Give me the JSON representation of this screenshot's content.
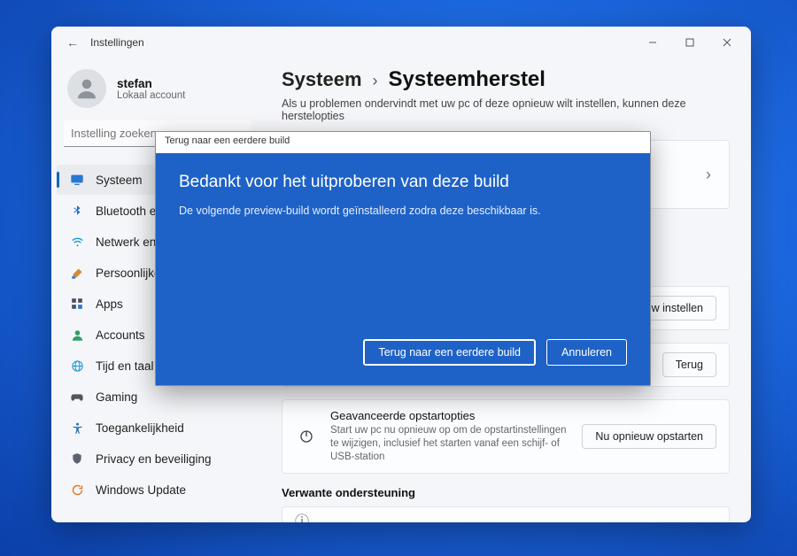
{
  "window": {
    "title": "Instellingen"
  },
  "user": {
    "name": "stefan",
    "account_type": "Lokaal account"
  },
  "search": {
    "placeholder": "Instelling zoeken"
  },
  "nav": [
    {
      "label": "Systeem",
      "icon": "🖥️",
      "key": "system",
      "active": true
    },
    {
      "label": "Bluetooth en",
      "icon": "bt",
      "key": "bluetooth"
    },
    {
      "label": "Netwerk en i",
      "icon": "📶",
      "key": "network"
    },
    {
      "label": "Persoonlijke",
      "icon": "🖌️",
      "key": "personalization"
    },
    {
      "label": "Apps",
      "icon": "apps",
      "key": "apps"
    },
    {
      "label": "Accounts",
      "icon": "👤",
      "key": "accounts"
    },
    {
      "label": "Tijd en taal",
      "icon": "🌐",
      "key": "time"
    },
    {
      "label": "Gaming",
      "icon": "🎮",
      "key": "gaming"
    },
    {
      "label": "Toegankelijkheid",
      "icon": "acc",
      "key": "accessibility"
    },
    {
      "label": "Privacy en beveiliging",
      "icon": "🛡️",
      "key": "privacy"
    },
    {
      "label": "Windows Update",
      "icon": "🔄",
      "key": "update"
    }
  ],
  "breadcrumb": {
    "parent": "Systeem",
    "current": "Systeemherstel"
  },
  "intro": "Als u problemen ondervindt met uw pc of deze opnieuw wilt instellen, kunnen deze herstelopties",
  "cards": {
    "reset": {
      "btn": "nieuw instellen"
    },
    "goback": {
      "btn": "Terug"
    },
    "advboot": {
      "title": "Geavanceerde opstartopties",
      "desc": "Start uw pc nu opnieuw op om de opstartinstellingen te wijzigen, inclusief het starten vanaf een schijf- of USB-station",
      "btn": "Nu opnieuw opstarten"
    }
  },
  "related": {
    "heading": "Verwante ondersteuning"
  },
  "modal": {
    "title": "Terug naar een eerdere build",
    "heading": "Bedankt voor het uitproberen van deze build",
    "body": "De volgende preview-build wordt geïnstalleerd zodra deze beschikbaar is.",
    "primary": "Terug naar een eerdere build",
    "cancel": "Annuleren"
  }
}
